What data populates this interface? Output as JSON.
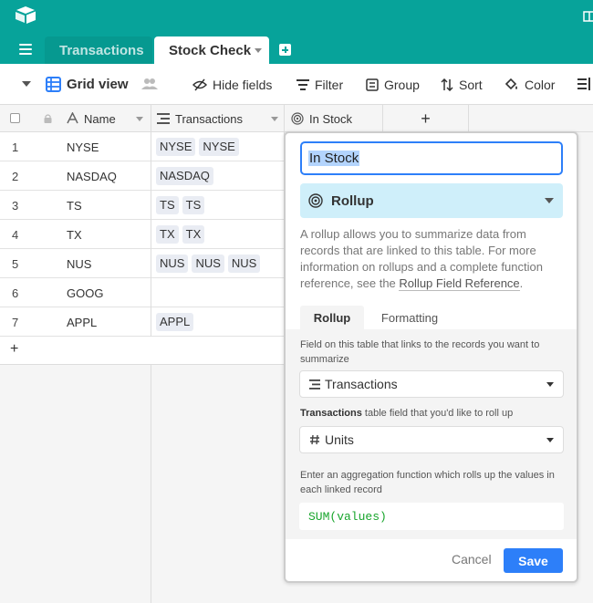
{
  "app": {
    "tabs": [
      {
        "label": "Transactions"
      },
      {
        "label": "Stock Check"
      }
    ]
  },
  "toolbar": {
    "view_name": "Grid view",
    "hide_fields": "Hide fields",
    "filter": "Filter",
    "group": "Group",
    "sort": "Sort",
    "color": "Color"
  },
  "grid": {
    "columns": [
      {
        "label": "Name"
      },
      {
        "label": "Transactions"
      },
      {
        "label": "In Stock"
      }
    ],
    "add_column": "+",
    "add_row": "+",
    "rows": [
      {
        "num": "1",
        "name": "NYSE",
        "transactions": [
          "NYSE",
          "NYSE"
        ]
      },
      {
        "num": "2",
        "name": "NASDAQ",
        "transactions": [
          "NASDAQ"
        ]
      },
      {
        "num": "3",
        "name": "TS",
        "transactions": [
          "TS",
          "TS"
        ]
      },
      {
        "num": "4",
        "name": "TX",
        "transactions": [
          "TX",
          "TX"
        ]
      },
      {
        "num": "5",
        "name": "NUS",
        "transactions": [
          "NUS",
          "NUS",
          "NUS"
        ]
      },
      {
        "num": "6",
        "name": "GOOG",
        "transactions": []
      },
      {
        "num": "7",
        "name": "APPL",
        "transactions": [
          "APPL"
        ]
      }
    ]
  },
  "popup": {
    "field_name": "In Stock",
    "field_type": "Rollup",
    "description": "A rollup allows you to summarize data from records that are linked to this table. For more information on rollups and a complete function reference, see the",
    "description_link": "Rollup Field Reference",
    "description_end": ".",
    "tabs": [
      {
        "label": "Rollup"
      },
      {
        "label": "Formatting"
      }
    ],
    "link_field_label": "Field on this table that links to the records you want to summarize",
    "link_field_value": "Transactions",
    "rollup_field_label_bold": "Transactions",
    "rollup_field_label_rest": " table field that you'd like to roll up",
    "rollup_field_value": "Units",
    "aggregation_label": "Enter an aggregation function which rolls up the values in each linked record",
    "aggregation_formula": "SUM(values)",
    "cancel": "Cancel",
    "save": "Save"
  },
  "colors": {
    "header_bg": "#07a39a",
    "primary_blue": "#2d7ff9",
    "rollup_bg": "#cfeffa",
    "formula_green": "#18a52c"
  }
}
